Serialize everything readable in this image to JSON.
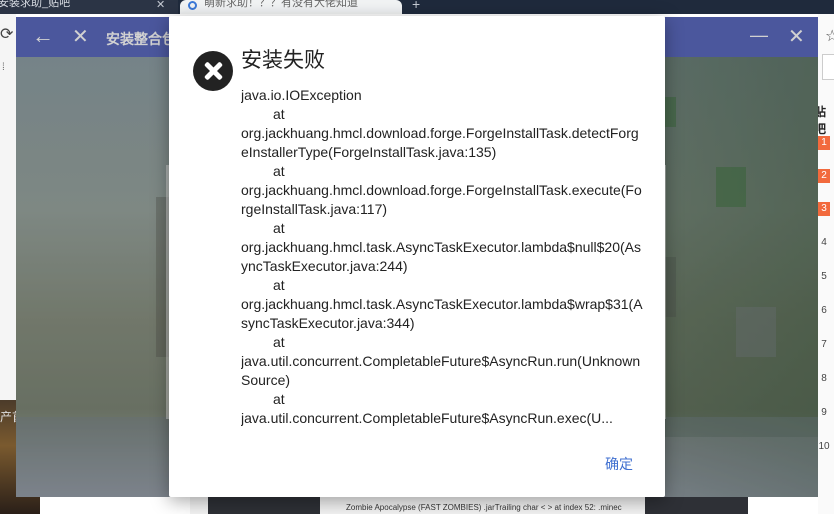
{
  "browser": {
    "tabs": [
      {
        "label": "安装求助_贴吧",
        "close": "✕"
      },
      {
        "label": "萌新求助！？？有没有大佬知道",
        "close": "✕"
      }
    ],
    "new_tab": "+",
    "sidebar_heading": "贴吧",
    "ranks": [
      "1",
      "2",
      "3",
      "4",
      "5",
      "6",
      "7",
      "8",
      "9",
      "10"
    ],
    "left_text": "产首",
    "bottom_note": "Zombie Apocalypse (FAST ZOMBIES) .jarTrailing char < > at index 52: .minec"
  },
  "launcher": {
    "title": "安装整合包"
  },
  "dialog": {
    "title": "安装失败",
    "ok_label": "确定",
    "trace": [
      {
        "text": "java.io.IOException",
        "kind": "line"
      },
      {
        "text": "at",
        "kind": "at"
      },
      {
        "text": "org.jackhuang.hmcl.download.forge.ForgeInstallTask.detectForgeInstallerType(ForgeInstallTask.java:135)",
        "kind": "line"
      },
      {
        "text": "at",
        "kind": "at"
      },
      {
        "text": "org.jackhuang.hmcl.download.forge.ForgeInstallTask.execute(ForgeInstallTask.java:117)",
        "kind": "line"
      },
      {
        "text": "at",
        "kind": "at"
      },
      {
        "text": "org.jackhuang.hmcl.task.AsyncTaskExecutor.lambda$null$20(AsyncTaskExecutor.java:244)",
        "kind": "line"
      },
      {
        "text": "at",
        "kind": "at"
      },
      {
        "text": "org.jackhuang.hmcl.task.AsyncTaskExecutor.lambda$wrap$31(AsyncTaskExecutor.java:344)",
        "kind": "line"
      },
      {
        "text": "at",
        "kind": "at"
      },
      {
        "text": "java.util.concurrent.CompletableFuture$AsyncRun.run(Unknown Source)",
        "kind": "line"
      },
      {
        "text": "at",
        "kind": "at"
      },
      {
        "text": "java.util.concurrent.CompletableFuture$AsyncRun.exec(U...",
        "kind": "last"
      }
    ]
  },
  "colors": {
    "launcher_accent": "#5c6bc0",
    "ok_button": "#3f6fd0",
    "rank_hot": "#f26a3d"
  }
}
